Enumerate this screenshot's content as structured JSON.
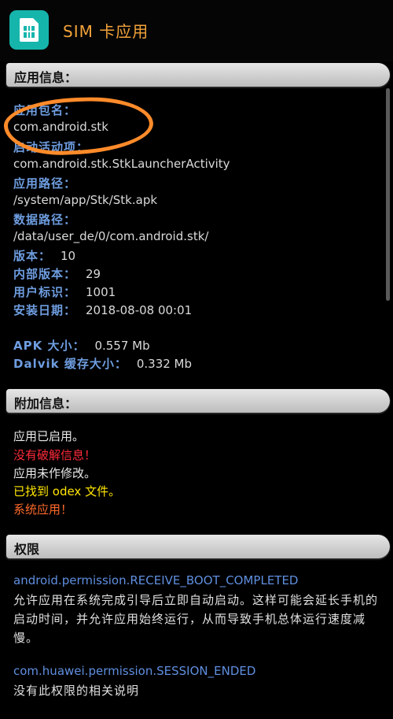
{
  "header": {
    "title": "SIM 卡应用"
  },
  "app_info": {
    "section_title": "应用信息：",
    "package_label": "应用包名：",
    "package_value": "com.android.stk",
    "activity_label": "启动活动项：",
    "activity_value": "com.android.stk.StkLauncherActivity",
    "path_label": "应用路径：",
    "path_value": "/system/app/Stk/Stk.apk",
    "data_label": "数据路径：",
    "data_value": "/data/user_de/0/com.android.stk/",
    "version_label": "版本：",
    "version_value": "10",
    "internal_version_label": "内部版本：",
    "internal_version_value": "29",
    "user_id_label": "用户标识：",
    "user_id_value": "1001",
    "install_date_label": "安装日期：",
    "install_date_value": "2018-08-08 00:01",
    "apk_size_label": "APK 大小：",
    "apk_size_value": "0.557 Mb",
    "dalvik_label": "Dalvik 缓存大小：",
    "dalvik_value": "0.332 Mb"
  },
  "extra_info": {
    "section_title": "附加信息：",
    "enabled": "应用已启用。",
    "no_crack": "没有破解信息！",
    "not_modified": "应用未作修改。",
    "odex_found": "已找到 odex 文件。",
    "system_app": "系统应用！"
  },
  "permissions": {
    "section_title": "权限",
    "items": [
      {
        "name": "android.permission.RECEIVE_BOOT_COMPLETED",
        "description": "允许应用在系统完成引导后立即自动启动。这样可能会延长手机的启动时间，并允许应用始终运行，从而导致手机总体运行速度减慢。"
      },
      {
        "name": "com.huawei.permission.SESSION_ENDED",
        "description": "没有此权限的相关说明"
      }
    ]
  },
  "colors": {
    "label_blue": "#6e9de0",
    "warning_red": "#ff2a3a",
    "highlight_yellow": "#ffe600",
    "system_orange": "#ff6a2b",
    "annotation_orange": "#ff8b2a",
    "icon_teal": "#16b5ac"
  },
  "icons": {
    "app_icon": "sim-card-icon"
  }
}
